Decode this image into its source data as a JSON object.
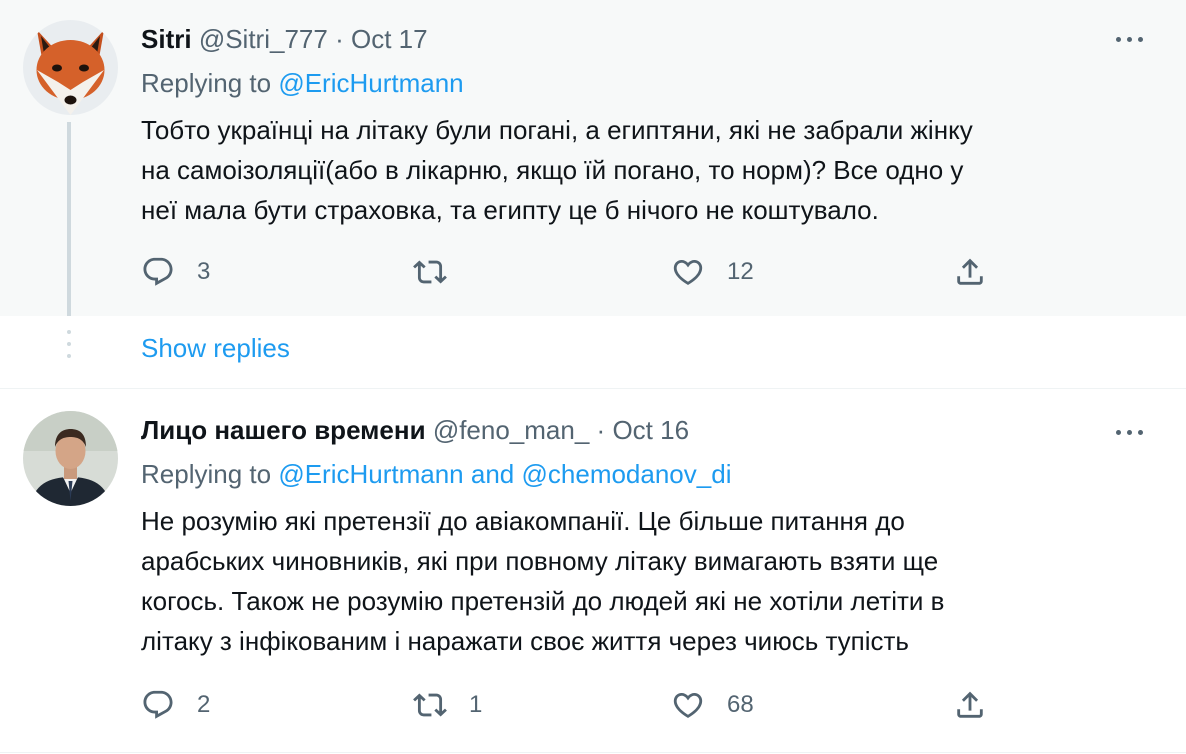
{
  "tweets": [
    {
      "author_name": "Sitri",
      "handle": "@Sitri_777",
      "separator": "·",
      "date": "Oct 17",
      "replying_prefix": "Replying to",
      "replying_to_1": "@EricHurtmann",
      "text_lines": [
        "Тобто українці на літаку були погані, а египтяни, які не забрали жінку",
        "на самоізоляції(або в лікарню, якщо їй погано, то норм)? Все одно у",
        "неї мала бути страховка, та египту це б нічого не коштувало."
      ],
      "replies": "3",
      "retweets": "",
      "likes": "12",
      "avatar_icon": "fox-avatar-icon"
    },
    {
      "author_name": "Лицо нашего времени",
      "handle": "@feno_man_",
      "separator": "·",
      "date": "Oct 16",
      "replying_prefix": "Replying to",
      "replying_to_1": "@EricHurtmann",
      "replying_and": "and",
      "replying_to_2": "@chemodanov_di",
      "text_lines": [
        "Не розумію які претензії до авіакомпанії. Це більше питання до",
        "арабських чиновників, які при повному літаку вимагають взяти ще",
        "когось. Також не розумію претензій до людей які не хотіли летіти в",
        "літаку з інфікованим і наражати своє життя через чиюсь тупість"
      ],
      "replies": "2",
      "retweets": "1",
      "likes": "68",
      "avatar_icon": "man-portrait-avatar-icon"
    }
  ],
  "show_replies_label": "Show replies",
  "colors": {
    "accent": "#1d9bf0",
    "muted": "#536471",
    "highlight_bg": "#f7f9f9",
    "thread_line": "#cfd9de"
  },
  "icons": [
    "reply-icon",
    "retweet-icon",
    "like-icon",
    "share-icon",
    "more-icon"
  ]
}
